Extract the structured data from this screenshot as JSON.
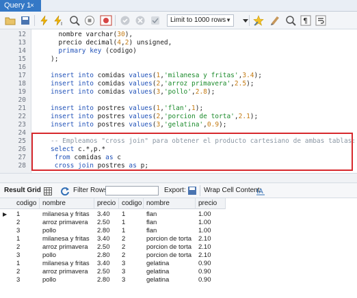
{
  "tab": {
    "label": "Query 1",
    "close": "×"
  },
  "toolbar": {
    "limit_label": "Limit to 1000 rows"
  },
  "editor": {
    "lines": [
      {
        "n": "12",
        "html": "  nombre varchar(<span class='num'>30</span>),"
      },
      {
        "n": "13",
        "html": "  precio decimal(<span class='num'>4</span>,<span class='num'>2</span>) unsigned,"
      },
      {
        "n": "14",
        "html": "  <span class='kw'>primary key</span> (codigo)"
      },
      {
        "n": "15",
        "html": ");"
      },
      {
        "n": "16",
        "html": ""
      },
      {
        "n": "17",
        "html": "<span class='kw'>insert into</span> comidas <span class='kw'>values</span>(<span class='num'>1</span>,<span class='str'>'milanesa y fritas'</span>,<span class='num'>3.4</span>);"
      },
      {
        "n": "18",
        "html": "<span class='kw'>insert into</span> comidas <span class='kw'>values</span>(<span class='num'>2</span>,<span class='str'>'arroz primavera'</span>,<span class='num'>2.5</span>);"
      },
      {
        "n": "19",
        "html": "<span class='kw'>insert into</span> comidas <span class='kw'>values</span>(<span class='num'>3</span>,<span class='str'>'pollo'</span>,<span class='num'>2.8</span>);"
      },
      {
        "n": "20",
        "html": ""
      },
      {
        "n": "21",
        "html": "<span class='kw'>insert into</span> postres <span class='kw'>values</span>(<span class='num'>1</span>,<span class='str'>'flan'</span>,<span class='num'>1</span>);"
      },
      {
        "n": "22",
        "html": "<span class='kw'>insert into</span> postres <span class='kw'>values</span>(<span class='num'>2</span>,<span class='str'>'porcion de torta'</span>,<span class='num'>2.1</span>);"
      },
      {
        "n": "23",
        "html": "<span class='kw'>insert into</span> postres <span class='kw'>values</span>(<span class='num'>3</span>,<span class='str'>'gelatina'</span>,<span class='num'>0.9</span>);"
      },
      {
        "n": "24",
        "html": ""
      },
      {
        "n": "25",
        "html": "<span class='cm'>-- Empleamos \"cross join\" para obtener el producto cartesiano de ambas tablas:</span>"
      },
      {
        "n": "26",
        "html": "<span class='kw'>select</span> c.*,p.*"
      },
      {
        "n": "27",
        "html": " <span class='kw'>from</span> comidas <span class='kw'>as</span> c"
      },
      {
        "n": "28",
        "html": " <span class='kw'>cross join</span> postres <span class='kw'>as</span> p;"
      }
    ]
  },
  "results": {
    "result_grid_label": "Result Grid",
    "filter_rows_label": "Filter Rows:",
    "export_label": "Export:",
    "wrap_label": "Wrap Cell Content:",
    "columns": [
      "codigo",
      "nombre",
      "precio",
      "codigo",
      "nombre",
      "precio"
    ],
    "rows": [
      [
        "1",
        "milanesa y fritas",
        "3.40",
        "1",
        "flan",
        "1.00"
      ],
      [
        "2",
        "arroz primavera",
        "2.50",
        "1",
        "flan",
        "1.00"
      ],
      [
        "3",
        "pollo",
        "2.80",
        "1",
        "flan",
        "1.00"
      ],
      [
        "1",
        "milanesa y fritas",
        "3.40",
        "2",
        "porcion de torta",
        "2.10"
      ],
      [
        "2",
        "arroz primavera",
        "2.50",
        "2",
        "porcion de torta",
        "2.10"
      ],
      [
        "3",
        "pollo",
        "2.80",
        "2",
        "porcion de torta",
        "2.10"
      ],
      [
        "1",
        "milanesa y fritas",
        "3.40",
        "3",
        "gelatina",
        "0.90"
      ],
      [
        "2",
        "arroz primavera",
        "2.50",
        "3",
        "gelatina",
        "0.90"
      ],
      [
        "3",
        "pollo",
        "2.80",
        "3",
        "gelatina",
        "0.90"
      ]
    ],
    "current_row_marker": "▶"
  },
  "colors": {
    "tab": "#3478c6",
    "keyword": "#1f51b8",
    "string": "#1a8a2a",
    "number": "#c47a11",
    "comment": "#8a96a3",
    "highlight": "#d6272b"
  }
}
